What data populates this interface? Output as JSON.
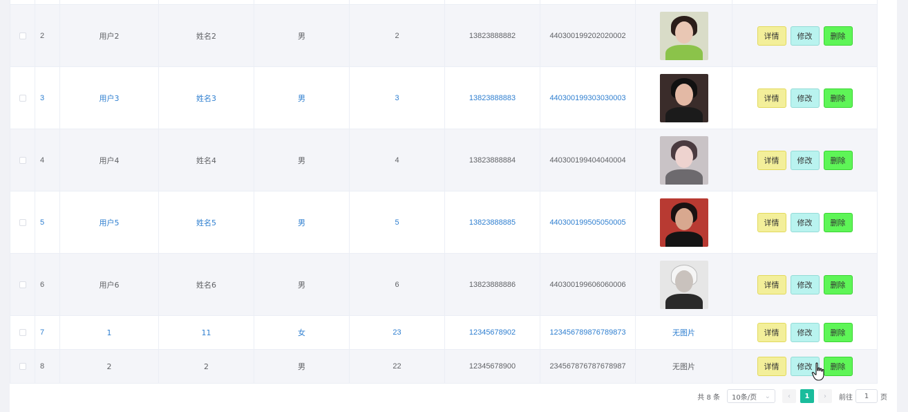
{
  "table": {
    "rows": [
      {
        "index": "2",
        "username": "用户2",
        "name": "姓名2",
        "sex": "男",
        "age": "2",
        "phone": "13823888882",
        "idcard": "440300199202020002",
        "photo": "avatar-2",
        "photo_text": ""
      },
      {
        "index": "3",
        "username": "用户3",
        "name": "姓名3",
        "sex": "男",
        "age": "3",
        "phone": "13823888883",
        "idcard": "440300199303030003",
        "photo": "avatar-3",
        "photo_text": ""
      },
      {
        "index": "4",
        "username": "用户4",
        "name": "姓名4",
        "sex": "男",
        "age": "4",
        "phone": "13823888884",
        "idcard": "440300199404040004",
        "photo": "avatar-4",
        "photo_text": ""
      },
      {
        "index": "5",
        "username": "用户5",
        "name": "姓名5",
        "sex": "男",
        "age": "5",
        "phone": "13823888885",
        "idcard": "440300199505050005",
        "photo": "avatar-5",
        "photo_text": ""
      },
      {
        "index": "6",
        "username": "用户6",
        "name": "姓名6",
        "sex": "男",
        "age": "6",
        "phone": "13823888886",
        "idcard": "440300199606060006",
        "photo": "avatar-6",
        "photo_text": ""
      },
      {
        "index": "7",
        "username": "1",
        "name": "11",
        "sex": "女",
        "age": "23",
        "phone": "12345678902",
        "idcard": "123456789876789873",
        "photo": "",
        "photo_text": "无图片"
      },
      {
        "index": "8",
        "username": "2",
        "name": "2",
        "sex": "男",
        "age": "22",
        "phone": "12345678900",
        "idcard": "234567876787678987",
        "photo": "",
        "photo_text": "无图片"
      }
    ],
    "actions": {
      "detail_label": "详情",
      "edit_label": "修改",
      "delete_label": "删除"
    }
  },
  "pagination": {
    "total_text": "共 8 条",
    "page_size_label": "10条/页",
    "current_page": "1",
    "goto_prefix": "前往",
    "goto_value": "1",
    "goto_suffix": "页"
  },
  "colors": {
    "detail_button": "#f3ef9a",
    "edit_button": "#b9f3ef",
    "delete_button": "#5ef557",
    "active_page": "#1abc9c",
    "link_text": "#2f7fd0"
  }
}
